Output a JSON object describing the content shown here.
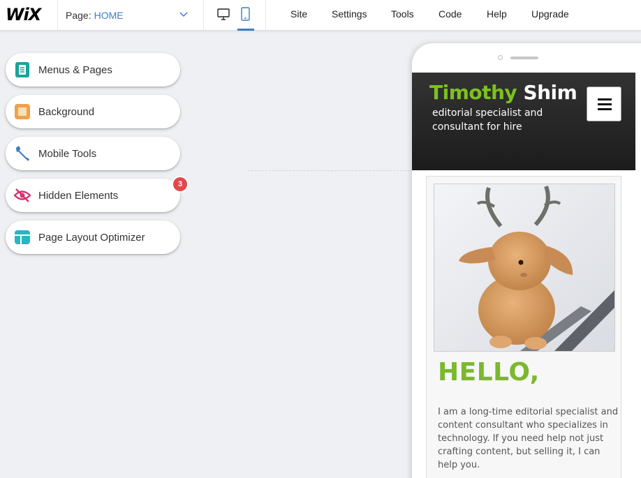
{
  "topbar": {
    "logo": "WiX",
    "page_label": "Page:",
    "page_value": "HOME",
    "menu": [
      "Site",
      "Settings",
      "Tools",
      "Code",
      "Help",
      "Upgrade"
    ],
    "active_device": "mobile"
  },
  "tools": [
    {
      "label": "Menus & Pages",
      "icon": "menus-pages-icon",
      "color": "#1aa39a"
    },
    {
      "label": "Background",
      "icon": "background-icon",
      "color": "#f0a14a"
    },
    {
      "label": "Mobile Tools",
      "icon": "wrench-icon",
      "color": "#3b7dc2"
    },
    {
      "label": "Hidden Elements",
      "icon": "hidden-eye-icon",
      "color": "#d6336c",
      "badge": "3"
    },
    {
      "label": "Page Layout Optimizer",
      "icon": "layout-icon",
      "color": "#26b6c4"
    }
  ],
  "site": {
    "name_first": "Timothy",
    "name_last": "Shim",
    "tagline": "editorial specialist and consultant for hire",
    "heading": "HELLO,",
    "bio": "I am a long-time editorial specialist and content consultant who specializes in technology. If you need help not just crafting content, but selling it, I can help you.",
    "accent_color": "#7cc11e"
  }
}
